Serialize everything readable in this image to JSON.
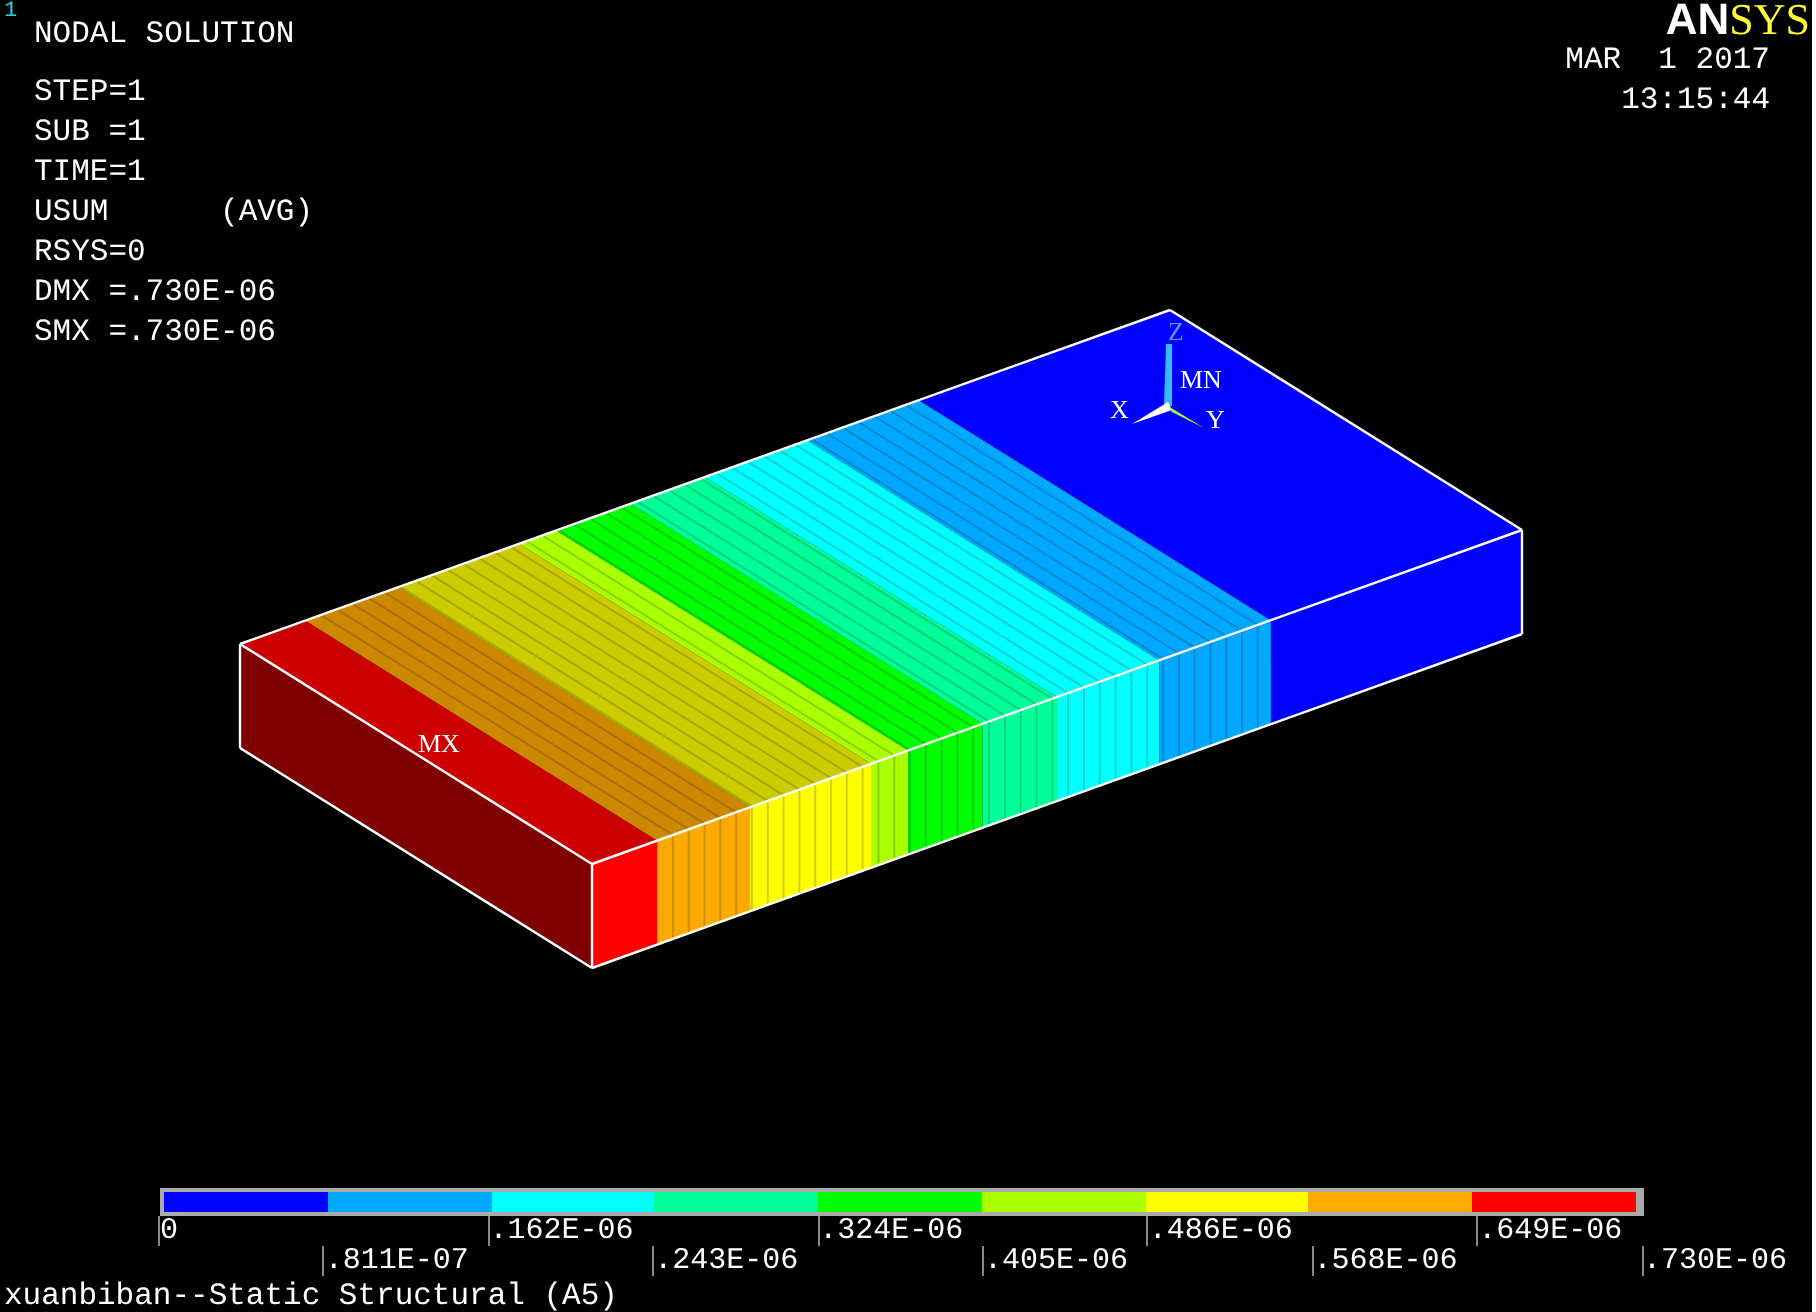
{
  "window_number": "1",
  "header": {
    "title": "NODAL SOLUTION",
    "lines": [
      "STEP=1",
      "SUB =1",
      "TIME=1",
      "USUM      (AVG)",
      "RSYS=0",
      "DMX =.730E-06",
      "SMX =.730E-06"
    ]
  },
  "logo": {
    "part_1": "AN",
    "part_2": "SYS"
  },
  "date": "MAR  1 2017",
  "time": "13:15:44",
  "model": {
    "max_label": "MX",
    "min_label": "MN",
    "axes": {
      "x": "X",
      "y": "Y",
      "z": "Z"
    }
  },
  "legend": {
    "segments": [
      {
        "color": "#0000ff"
      },
      {
        "color": "#00a8ff"
      },
      {
        "color": "#00ffff"
      },
      {
        "color": "#00ff99"
      },
      {
        "color": "#00ff00"
      },
      {
        "color": "#aaff00"
      },
      {
        "color": "#ffff00"
      },
      {
        "color": "#ffaa00"
      },
      {
        "color": "#ff0000"
      }
    ],
    "labels": [
      "0",
      ".811E-07",
      ".162E-06",
      ".243E-06",
      ".324E-06",
      ".405E-06",
      ".486E-06",
      ".568E-06",
      ".649E-06",
      ".730E-06"
    ]
  },
  "footer": "xuanbiban--Static Structural (A5)"
}
